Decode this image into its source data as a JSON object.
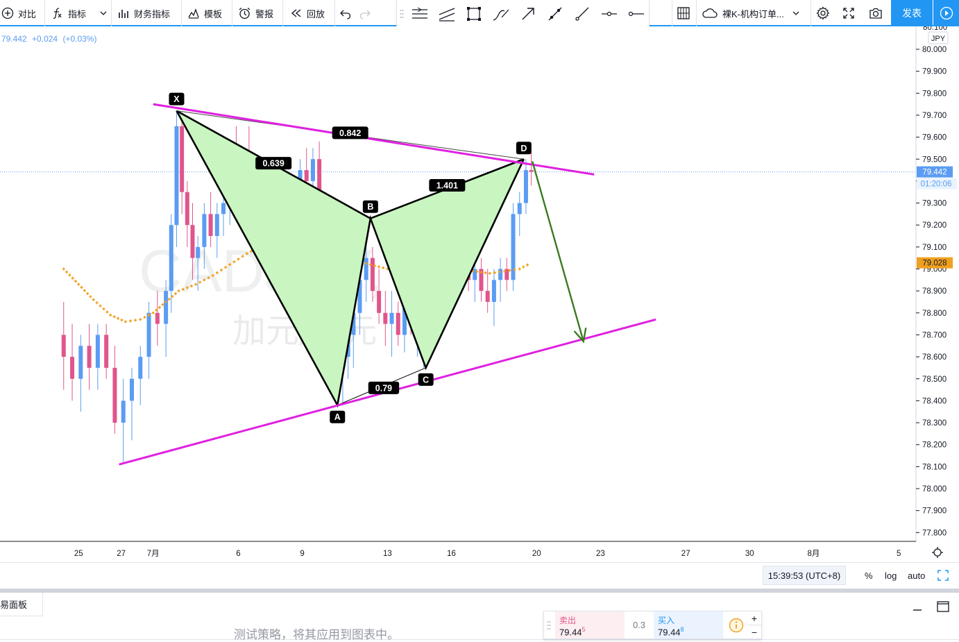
{
  "toolbar": {
    "compare_label": "对比",
    "indicators_label": "指标",
    "financials_label": "财务指标",
    "template_label": "模板",
    "alert_label": "警报",
    "replay_label": "回放",
    "layout_name": "裸K-机构订单...",
    "publish_label": "发表"
  },
  "legend": {
    "price": "79.442",
    "change": "+0.024",
    "change_pct": "(+0.03%)"
  },
  "watermark": {
    "symbol": "CADJPY, 4h",
    "description": "加元/日元"
  },
  "price_axis": {
    "currency": "JPY",
    "top_cut_label": "80.100",
    "labels": [
      "80.000",
      "79.900",
      "79.800",
      "79.700",
      "79.600",
      "79.500",
      "79.400",
      "79.300",
      "79.200",
      "79.100",
      "79.000",
      "78.900",
      "78.800",
      "78.700",
      "78.600",
      "78.500",
      "78.400",
      "78.300",
      "78.200",
      "78.100",
      "78.000",
      "77.900",
      "77.800"
    ],
    "last_price_label": "79.442",
    "countdown_label": "01:20:06",
    "ma_label": "79.028"
  },
  "time_axis": {
    "labels": [
      {
        "text": "25",
        "x": -2.5
      },
      {
        "text": "27",
        "x": -0.5
      },
      {
        "text": "7月",
        "x": 1
      },
      {
        "text": "6",
        "x": 5
      },
      {
        "text": "9",
        "x": 8
      },
      {
        "text": "13",
        "x": 12
      },
      {
        "text": "16",
        "x": 15
      },
      {
        "text": "20",
        "x": 19
      },
      {
        "text": "23",
        "x": 22
      },
      {
        "text": "27",
        "x": 26
      },
      {
        "text": "30",
        "x": 29
      },
      {
        "text": "8月",
        "x": 32
      },
      {
        "text": "5",
        "x": 36
      }
    ]
  },
  "pattern_labels": {
    "X": "X",
    "A": "A",
    "B": "B",
    "C": "C",
    "D": "D",
    "xb_ratio": "0.639",
    "xd_ratio": "0.842",
    "bd_ratio": "1.401",
    "ac_ratio": "0.79"
  },
  "colors": {
    "up": "#5b9cf3",
    "down": "#e0558c",
    "trendline": "#e020e0",
    "harmonic_fill": "#c8f5c0",
    "arrow": "#3a7a1e",
    "ma": "#f0a020",
    "accent": "#2196f3"
  },
  "status": {
    "time": "15:39:53 (UTC+8)",
    "percent": "%",
    "log": "log",
    "auto": "auto"
  },
  "bottom_panel": {
    "tab": "交易面板",
    "message": "测试策略，将其应用到图表中。"
  },
  "trade": {
    "sell_label": "卖出",
    "sell_price": "79.44",
    "sell_sup": "5",
    "spread": "0.3",
    "buy_label": "买入",
    "buy_price": "79.44",
    "buy_sup": "8"
  },
  "chart_data": {
    "type": "candlestick",
    "symbol": "CADJPY",
    "interval": "4h",
    "title": "CADJPY, 4h",
    "subtitle": "加元/日元",
    "ylim": [
      77.75,
      80.13
    ],
    "last_price": 79.442,
    "ma_last": 79.028,
    "candles": [
      {
        "d": -3.2,
        "o": 78.7,
        "h": 78.85,
        "l": 78.45,
        "c": 78.6
      },
      {
        "d": -2.8,
        "o": 78.6,
        "h": 78.75,
        "l": 78.4,
        "c": 78.5
      },
      {
        "d": -2.4,
        "o": 78.5,
        "h": 78.7,
        "l": 78.35,
        "c": 78.65
      },
      {
        "d": -2.0,
        "o": 78.65,
        "h": 78.75,
        "l": 78.45,
        "c": 78.55
      },
      {
        "d": -1.6,
        "o": 78.55,
        "h": 78.75,
        "l": 78.45,
        "c": 78.7
      },
      {
        "d": -1.2,
        "o": 78.7,
        "h": 78.75,
        "l": 78.5,
        "c": 78.55
      },
      {
        "d": -0.8,
        "o": 78.55,
        "h": 78.65,
        "l": 78.25,
        "c": 78.3
      },
      {
        "d": -0.4,
        "o": 78.3,
        "h": 78.5,
        "l": 78.12,
        "c": 78.4
      },
      {
        "d": 0.0,
        "o": 78.4,
        "h": 78.55,
        "l": 78.22,
        "c": 78.5
      },
      {
        "d": 0.4,
        "o": 78.5,
        "h": 78.65,
        "l": 78.38,
        "c": 78.6
      },
      {
        "d": 0.8,
        "o": 78.6,
        "h": 78.85,
        "l": 78.5,
        "c": 78.8
      },
      {
        "d": 1.2,
        "o": 78.8,
        "h": 78.9,
        "l": 78.65,
        "c": 78.75
      },
      {
        "d": 1.6,
        "o": 78.75,
        "h": 78.95,
        "l": 78.6,
        "c": 78.9
      },
      {
        "d": 1.85,
        "o": 78.9,
        "h": 79.25,
        "l": 78.8,
        "c": 79.2
      },
      {
        "d": 2.1,
        "o": 79.2,
        "h": 79.72,
        "l": 79.1,
        "c": 79.65
      },
      {
        "d": 2.35,
        "o": 79.65,
        "h": 79.7,
        "l": 79.25,
        "c": 79.35
      },
      {
        "d": 2.6,
        "o": 79.35,
        "h": 79.4,
        "l": 79.1,
        "c": 79.2
      },
      {
        "d": 2.85,
        "o": 79.2,
        "h": 79.3,
        "l": 78.95,
        "c": 79.05
      },
      {
        "d": 3.1,
        "o": 79.05,
        "h": 79.15,
        "l": 78.9,
        "c": 79.1
      },
      {
        "d": 3.4,
        "o": 79.1,
        "h": 79.3,
        "l": 79.0,
        "c": 79.25
      },
      {
        "d": 3.7,
        "o": 79.25,
        "h": 79.35,
        "l": 79.1,
        "c": 79.15
      },
      {
        "d": 4.0,
        "o": 79.15,
        "h": 79.3,
        "l": 79.05,
        "c": 79.25
      },
      {
        "d": 4.3,
        "o": 79.25,
        "h": 79.4,
        "l": 79.15,
        "c": 79.3
      },
      {
        "d": 4.6,
        "o": 79.3,
        "h": 79.55,
        "l": 79.2,
        "c": 79.5
      },
      {
        "d": 4.9,
        "o": 79.5,
        "h": 79.65,
        "l": 79.3,
        "c": 79.35
      },
      {
        "d": 5.2,
        "o": 79.35,
        "h": 79.5,
        "l": 79.2,
        "c": 79.45
      },
      {
        "d": 5.5,
        "o": 79.45,
        "h": 79.65,
        "l": 79.35,
        "c": 79.4
      },
      {
        "d": 5.8,
        "o": 79.4,
        "h": 79.5,
        "l": 79.25,
        "c": 79.3
      },
      {
        "d": 6.1,
        "o": 79.3,
        "h": 79.45,
        "l": 79.15,
        "c": 79.35
      },
      {
        "d": 6.4,
        "o": 79.35,
        "h": 79.4,
        "l": 79.15,
        "c": 79.2
      },
      {
        "d": 6.7,
        "o": 79.2,
        "h": 79.3,
        "l": 79.0,
        "c": 79.05
      },
      {
        "d": 7.0,
        "o": 79.05,
        "h": 79.25,
        "l": 78.95,
        "c": 79.2
      },
      {
        "d": 7.3,
        "o": 79.2,
        "h": 79.3,
        "l": 79.05,
        "c": 79.1
      },
      {
        "d": 7.6,
        "o": 79.1,
        "h": 79.35,
        "l": 79.0,
        "c": 79.3
      },
      {
        "d": 7.9,
        "o": 79.3,
        "h": 79.5,
        "l": 79.2,
        "c": 79.45
      },
      {
        "d": 8.2,
        "o": 79.45,
        "h": 79.55,
        "l": 79.3,
        "c": 79.4
      },
      {
        "d": 8.5,
        "o": 79.4,
        "h": 79.55,
        "l": 79.3,
        "c": 79.5
      },
      {
        "d": 8.8,
        "o": 79.5,
        "h": 79.58,
        "l": 79.2,
        "c": 79.25
      },
      {
        "d": 9.1,
        "o": 79.25,
        "h": 79.35,
        "l": 78.9,
        "c": 79.0
      },
      {
        "d": 9.4,
        "o": 79.0,
        "h": 79.05,
        "l": 78.7,
        "c": 78.8
      },
      {
        "d": 9.65,
        "o": 78.8,
        "h": 78.85,
        "l": 78.42,
        "c": 78.55
      },
      {
        "d": 9.9,
        "o": 78.55,
        "h": 78.65,
        "l": 78.38,
        "c": 78.6
      },
      {
        "d": 10.15,
        "o": 78.6,
        "h": 78.75,
        "l": 78.5,
        "c": 78.7
      },
      {
        "d": 10.4,
        "o": 78.7,
        "h": 78.85,
        "l": 78.55,
        "c": 78.8
      },
      {
        "d": 10.7,
        "o": 78.8,
        "h": 79.0,
        "l": 78.7,
        "c": 78.95
      },
      {
        "d": 11.0,
        "o": 78.95,
        "h": 79.2,
        "l": 78.85,
        "c": 79.05
      },
      {
        "d": 11.3,
        "o": 79.05,
        "h": 79.1,
        "l": 78.85,
        "c": 78.9
      },
      {
        "d": 11.6,
        "o": 78.9,
        "h": 79.0,
        "l": 78.75,
        "c": 78.8
      },
      {
        "d": 11.9,
        "o": 78.8,
        "h": 78.9,
        "l": 78.65,
        "c": 78.75
      },
      {
        "d": 12.2,
        "o": 78.75,
        "h": 78.9,
        "l": 78.6,
        "c": 78.8
      },
      {
        "d": 12.5,
        "o": 78.8,
        "h": 78.85,
        "l": 78.65,
        "c": 78.7
      },
      {
        "d": 12.8,
        "o": 78.7,
        "h": 78.9,
        "l": 78.62,
        "c": 78.85
      },
      {
        "d": 13.1,
        "o": 78.85,
        "h": 78.95,
        "l": 78.7,
        "c": 78.75
      },
      {
        "d": 13.4,
        "o": 78.75,
        "h": 78.9,
        "l": 78.6,
        "c": 78.85
      },
      {
        "d": 13.7,
        "o": 78.85,
        "h": 79.0,
        "l": 78.55,
        "c": 78.95
      },
      {
        "d": 14.0,
        "o": 78.95,
        "h": 79.25,
        "l": 78.85,
        "c": 79.2
      },
      {
        "d": 14.3,
        "o": 79.2,
        "h": 79.3,
        "l": 79.05,
        "c": 79.15
      },
      {
        "d": 14.6,
        "o": 79.15,
        "h": 79.3,
        "l": 79.05,
        "c": 79.25
      },
      {
        "d": 14.9,
        "o": 79.25,
        "h": 79.3,
        "l": 79.05,
        "c": 79.1
      },
      {
        "d": 15.2,
        "o": 79.1,
        "h": 79.2,
        "l": 78.95,
        "c": 79.15
      },
      {
        "d": 15.5,
        "o": 79.15,
        "h": 79.28,
        "l": 79.0,
        "c": 79.05
      },
      {
        "d": 15.8,
        "o": 79.05,
        "h": 79.15,
        "l": 78.9,
        "c": 78.95
      },
      {
        "d": 16.1,
        "o": 78.95,
        "h": 79.05,
        "l": 78.85,
        "c": 79.0
      },
      {
        "d": 16.4,
        "o": 79.0,
        "h": 79.05,
        "l": 78.85,
        "c": 78.9
      },
      {
        "d": 16.7,
        "o": 78.9,
        "h": 79.0,
        "l": 78.8,
        "c": 78.85
      },
      {
        "d": 17.0,
        "o": 78.85,
        "h": 79.0,
        "l": 78.74,
        "c": 78.95
      },
      {
        "d": 17.3,
        "o": 78.95,
        "h": 79.05,
        "l": 78.85,
        "c": 79.0
      },
      {
        "d": 17.6,
        "o": 79.0,
        "h": 79.05,
        "l": 78.9,
        "c": 78.95
      },
      {
        "d": 17.9,
        "o": 78.95,
        "h": 79.3,
        "l": 78.9,
        "c": 79.25
      },
      {
        "d": 18.2,
        "o": 79.25,
        "h": 79.35,
        "l": 79.15,
        "c": 79.3
      },
      {
        "d": 18.5,
        "o": 79.3,
        "h": 79.5,
        "l": 79.25,
        "c": 79.45
      },
      {
        "d": 18.75,
        "o": 79.45,
        "h": 79.53,
        "l": 79.38,
        "c": 79.442
      }
    ],
    "moving_average": [
      {
        "d": -3.2,
        "v": 79.0
      },
      {
        "d": -2.5,
        "v": 78.93
      },
      {
        "d": -1.8,
        "v": 78.86
      },
      {
        "d": -1.0,
        "v": 78.79
      },
      {
        "d": -0.3,
        "v": 78.76
      },
      {
        "d": 0.4,
        "v": 78.77
      },
      {
        "d": 1.0,
        "v": 78.8
      },
      {
        "d": 1.6,
        "v": 78.85
      },
      {
        "d": 2.2,
        "v": 78.9
      },
      {
        "d": 3.0,
        "v": 78.93
      },
      {
        "d": 3.8,
        "v": 78.97
      },
      {
        "d": 4.6,
        "v": 79.02
      },
      {
        "d": 5.4,
        "v": 79.07
      },
      {
        "d": 6.2,
        "v": 79.11
      },
      {
        "d": 7.0,
        "v": 79.14
      },
      {
        "d": 7.8,
        "v": 79.17
      },
      {
        "d": 8.5,
        "v": 79.2
      },
      {
        "d": 9.0,
        "v": 79.17
      },
      {
        "d": 9.6,
        "v": 79.12
      },
      {
        "d": 10.2,
        "v": 79.07
      },
      {
        "d": 10.8,
        "v": 79.03
      },
      {
        "d": 11.6,
        "v": 79.01
      },
      {
        "d": 12.4,
        "v": 78.99
      },
      {
        "d": 13.2,
        "v": 78.97
      },
      {
        "d": 13.8,
        "v": 78.95
      },
      {
        "d": 14.5,
        "v": 78.96
      },
      {
        "d": 15.2,
        "v": 78.98
      },
      {
        "d": 16.0,
        "v": 78.99
      },
      {
        "d": 16.8,
        "v": 78.98
      },
      {
        "d": 17.5,
        "v": 78.99
      },
      {
        "d": 18.2,
        "v": 79.0
      },
      {
        "d": 18.75,
        "v": 79.028
      }
    ],
    "harmonic_pattern": {
      "X": {
        "d": 2.1,
        "v": 79.72
      },
      "A": {
        "d": 9.65,
        "v": 78.38
      },
      "B": {
        "d": 11.2,
        "v": 79.23
      },
      "C": {
        "d": 13.8,
        "v": 78.55
      },
      "D": {
        "d": 18.4,
        "v": 79.5
      }
    },
    "trendlines": [
      {
        "name": "upper",
        "from": {
          "d": 1.0,
          "v": 79.75
        },
        "to": {
          "d": 21.7,
          "v": 79.43
        }
      },
      {
        "name": "lower",
        "from": {
          "d": -0.6,
          "v": 78.11
        },
        "to": {
          "d": 24.6,
          "v": 78.77
        }
      }
    ],
    "projection_arrow": {
      "from": {
        "d": 18.8,
        "v": 79.49
      },
      "to": {
        "d": 21.2,
        "v": 78.67
      }
    }
  }
}
